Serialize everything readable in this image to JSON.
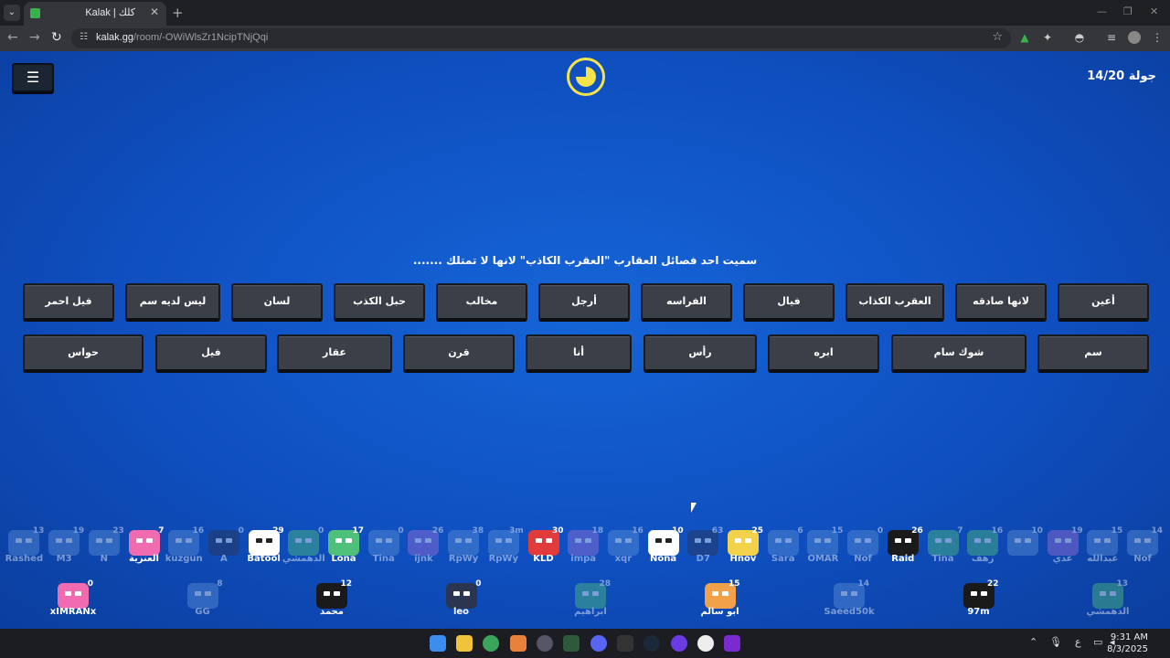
{
  "browser": {
    "tab_title": "Kalak | كلك",
    "url_host": "kalak.gg",
    "url_path": "/room/-OWiWlsZr1NcipTNjQqi"
  },
  "game": {
    "round_label": "جولة",
    "round_value": "14/20",
    "question": "سميت احد فصائل العقارب \"العقرب الكاذب\" لانها لا تمتلك .......",
    "options_row1": [
      "أعين",
      "لانها صادقه",
      "العقرب الكذاب",
      "فيال",
      "الفراسه",
      "أرجل",
      "مخالب",
      "حبل الكذب",
      "لسان",
      "ليس لديه سم",
      "فيل احمر"
    ],
    "options_row2": [
      "سم",
      "شوك سام",
      "ابره",
      "رأس",
      "أنا",
      "قرن",
      "عقار",
      "فيل",
      "حواس"
    ]
  },
  "players_row1": [
    {
      "name": "Nof",
      "score": "14",
      "color": "#5b8fd6",
      "dim": true
    },
    {
      "name": "عبدالله",
      "score": "15",
      "color": "#5b8fd6",
      "dim": true
    },
    {
      "name": "غدي",
      "score": "19",
      "color": "#9b6fd6",
      "dim": true
    },
    {
      "name": "",
      "score": "10",
      "color": "#5b8fd6",
      "dim": true
    },
    {
      "name": "زهف",
      "score": "16",
      "color": "#4fc07a",
      "dim": true
    },
    {
      "name": "Tina",
      "score": "7",
      "color": "#4fc07a",
      "dim": true
    },
    {
      "name": "Raid",
      "score": "26",
      "color": "#1a1a1a",
      "dim": false
    },
    {
      "name": "Nof",
      "score": "0",
      "color": "#5b8fd6",
      "dim": true
    },
    {
      "name": "OMAR",
      "score": "15",
      "color": "#5b8fd6",
      "dim": true
    },
    {
      "name": "Sara",
      "score": "6",
      "color": "#5b8fd6",
      "dim": true
    },
    {
      "name": "Hnov",
      "score": "25",
      "color": "#f2d24b",
      "dim": false
    },
    {
      "name": "D7",
      "score": "63",
      "color": "#2c3550",
      "dim": true
    },
    {
      "name": "Nona",
      "score": "10",
      "color": "#ffffff",
      "dim": false
    },
    {
      "name": "xqr",
      "score": "16",
      "color": "#5b8fd6",
      "dim": true
    },
    {
      "name": "impa",
      "score": "18",
      "color": "#9b6fd6",
      "dim": true
    },
    {
      "name": "KLD",
      "score": "30",
      "color": "#e23b3b",
      "dim": false
    },
    {
      "name": "RpWy",
      "score": "3m",
      "color": "#5b8fd6",
      "dim": true
    },
    {
      "name": "RpWy",
      "score": "38",
      "color": "#5b8fd6",
      "dim": true
    },
    {
      "name": "ijnk",
      "score": "26",
      "color": "#9b6fd6",
      "dim": true
    },
    {
      "name": "Tina",
      "score": "0",
      "color": "#5b8fd6",
      "dim": true
    },
    {
      "name": "Lona",
      "score": "17",
      "color": "#4fc07a",
      "dim": false
    },
    {
      "name": "الدهمشي",
      "score": "0",
      "color": "#4fc07a",
      "dim": true
    },
    {
      "name": "Batool",
      "score": "29",
      "color": "#ffffff",
      "dim": false
    },
    {
      "name": "A",
      "score": "0",
      "color": "#2c3550",
      "dim": true
    },
    {
      "name": "kuzgun",
      "score": "16",
      "color": "#5b8fd6",
      "dim": true
    },
    {
      "name": "العنزية",
      "score": "7",
      "color": "#f06bb0",
      "dim": false
    },
    {
      "name": "N",
      "score": "23",
      "color": "#5b8fd6",
      "dim": true
    },
    {
      "name": "M3",
      "score": "19",
      "color": "#5b8fd6",
      "dim": true
    },
    {
      "name": "Rashed",
      "score": "13",
      "color": "#5b8fd6",
      "dim": true
    }
  ],
  "players_row2": [
    {
      "name": "الدهمشي",
      "score": "13",
      "color": "#4fc07a",
      "dim": true
    },
    {
      "name": "97m",
      "score": "22",
      "color": "#1a1a1a",
      "dim": false
    },
    {
      "name": "Saeed50k",
      "score": "14",
      "color": "#5b8fd6",
      "dim": true
    },
    {
      "name": "ابو سالم",
      "score": "15",
      "color": "#f2a14b",
      "dim": false
    },
    {
      "name": "ابراهيم",
      "score": "28",
      "color": "#4fc07a",
      "dim": true
    },
    {
      "name": "leo",
      "score": "0",
      "color": "#2c3550",
      "dim": false
    },
    {
      "name": "محمد",
      "score": "12",
      "color": "#1a1a1a",
      "dim": false
    },
    {
      "name": "GG",
      "score": "8",
      "color": "#5b8fd6",
      "dim": true
    },
    {
      "name": "xIMRANx",
      "score": "0",
      "color": "#f06bb0",
      "dim": false
    }
  ],
  "taskbar": {
    "time": "9:31 AM",
    "date": "8/3/2025",
    "lang": "ع"
  }
}
